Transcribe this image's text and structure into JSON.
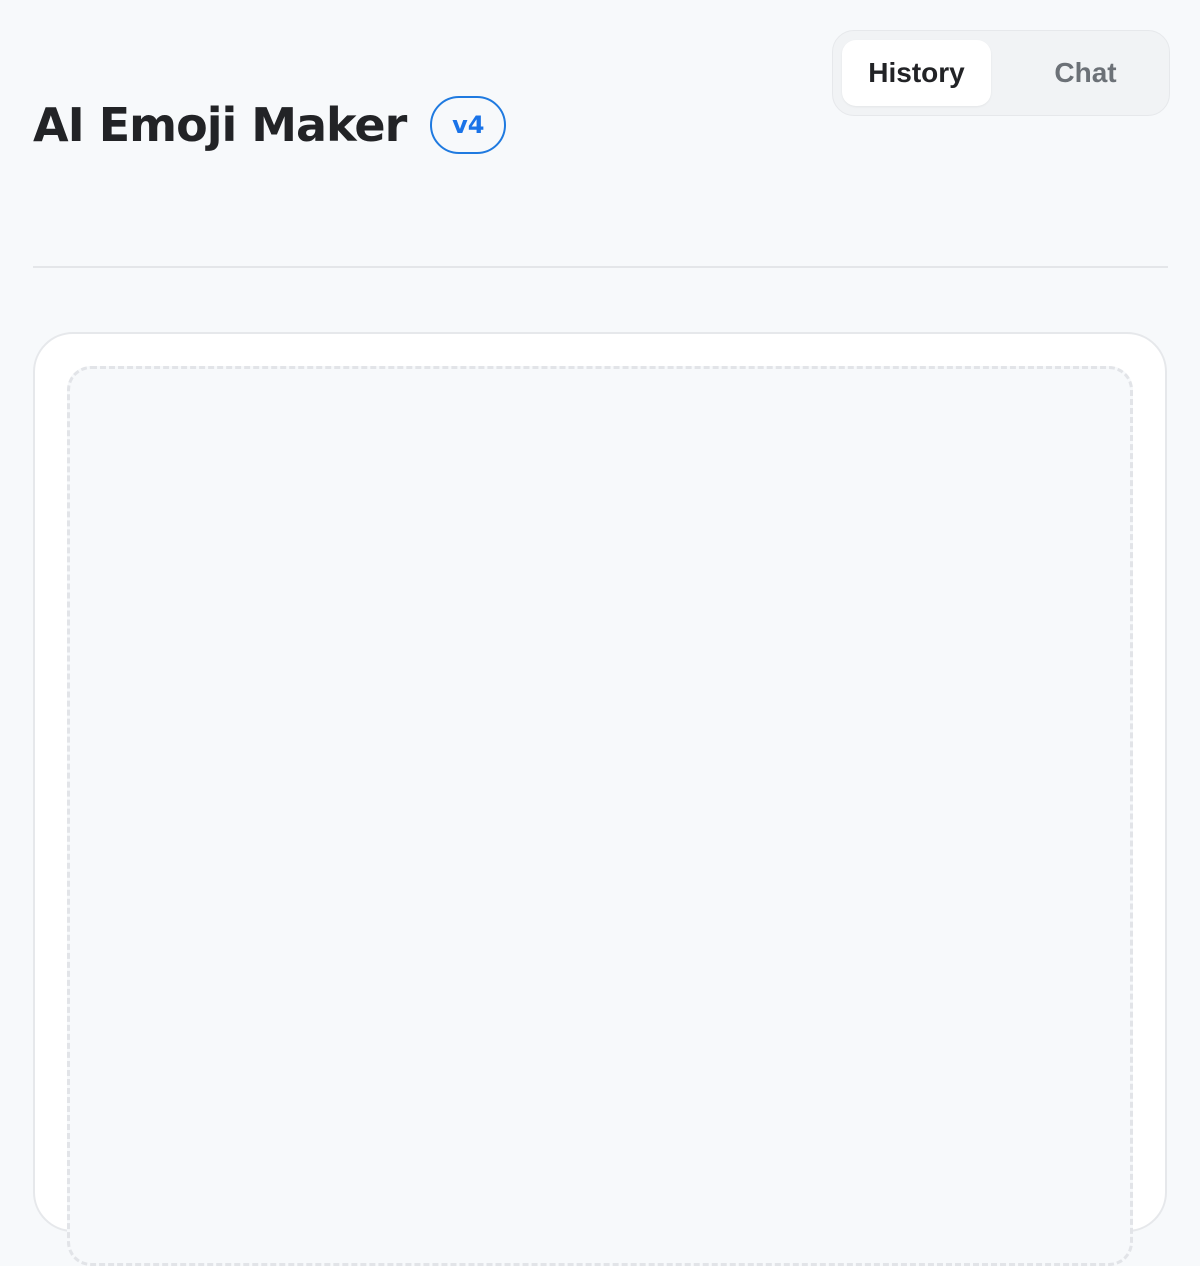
{
  "header": {
    "title": "AI Emoji Maker",
    "version": "v4"
  },
  "view_toggle": {
    "tabs": [
      {
        "label": "History",
        "active": true
      },
      {
        "label": "Chat",
        "active": false
      }
    ]
  },
  "colors": {
    "accent": "#1a73e8",
    "background": "#f7f9fb",
    "text": "#222326",
    "muted": "#6c7177"
  }
}
